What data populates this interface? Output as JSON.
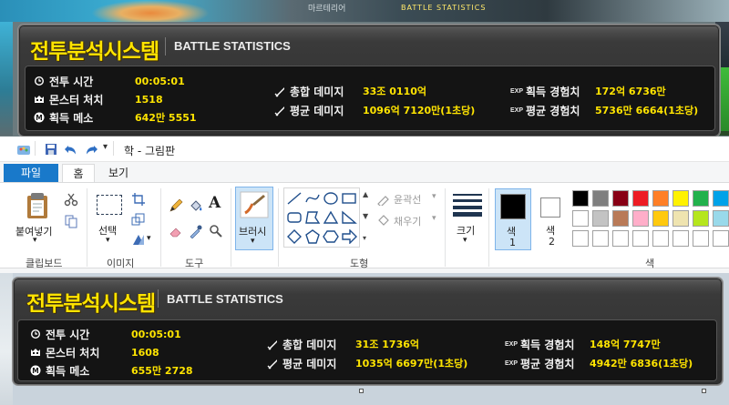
{
  "game_top": {
    "caption_title": "BATTLE STATISTICS",
    "caption_small": "마르테리어"
  },
  "panel_top": {
    "title_ko": "전투분석시스템",
    "title_en": "BATTLE STATISTICS",
    "battle_time_label": "전투 시간",
    "battle_time_value": "00:05:01",
    "monster_kills_label": "몬스터 처치",
    "monster_kills_value": "1518",
    "meso_label": "획득 메소",
    "meso_value": "642만 5551",
    "total_damage_label": "총합 데미지",
    "total_damage_value": "33조 0110억",
    "avg_damage_label": "평균 데미지",
    "avg_damage_value": "1096억 7120만(1초당)",
    "exp_gained_label": "획득 경험치",
    "exp_gained_value": "172억 6736만",
    "avg_exp_label": "평균 경험치",
    "avg_exp_value": "5736만 6664(1초당)",
    "exp_tag": "EXP"
  },
  "paint": {
    "window_title": "학 - 그림판",
    "tabs": [
      "파일",
      "홈",
      "보기"
    ],
    "clipboard": {
      "paste_label": "붙여넣기",
      "group_label": "클립보드"
    },
    "image": {
      "select_label": "선택",
      "group_label": "이미지"
    },
    "tools": {
      "group_label": "도구",
      "text_glyph": "A"
    },
    "brush": {
      "label": "브러시"
    },
    "shapes": {
      "outline_label": "윤곽선",
      "fill_label": "채우기",
      "group_label": "도형"
    },
    "size": {
      "label": "크기"
    },
    "color1": {
      "label_top": "색",
      "label_bottom": "1"
    },
    "color2": {
      "label_top": "색",
      "label_bottom": "2"
    },
    "colors": {
      "group_label": "색",
      "row1": [
        "#000000",
        "#7f7f7f",
        "#880015",
        "#ed1c24",
        "#ff7f27",
        "#fff200",
        "#22b14c",
        "#00a2e8"
      ],
      "row2": [
        "#ffffff",
        "#c3c3c3",
        "#b97a57",
        "#ffaec9",
        "#ffc90e",
        "#efe4b0",
        "#b5e61d",
        "#99d9ea"
      ],
      "row3": [
        "#ffffff",
        "#ffffff",
        "#ffffff",
        "#ffffff",
        "#ffffff",
        "#ffffff",
        "#ffffff",
        "#ffffff"
      ]
    },
    "color1_value": "#000000",
    "color2_value": "#ffffff"
  },
  "panel_bottom": {
    "title_ko": "전투분석시스템",
    "title_en": "BATTLE STATISTICS",
    "battle_time_label": "전투 시간",
    "battle_time_value": "00:05:01",
    "monster_kills_label": "몬스터 처치",
    "monster_kills_value": "1608",
    "meso_label": "획득 메소",
    "meso_value": "655만 2728",
    "total_damage_label": "총합 데미지",
    "total_damage_value": "31조 1736억",
    "avg_damage_label": "평균 데미지",
    "avg_damage_value": "1035억 6697만(1초당)",
    "exp_gained_label": "획득 경험치",
    "exp_gained_value": "148억 7747만",
    "avg_exp_label": "평균 경험치",
    "avg_exp_value": "4942만 6836(1초당)",
    "exp_tag": "EXP"
  }
}
